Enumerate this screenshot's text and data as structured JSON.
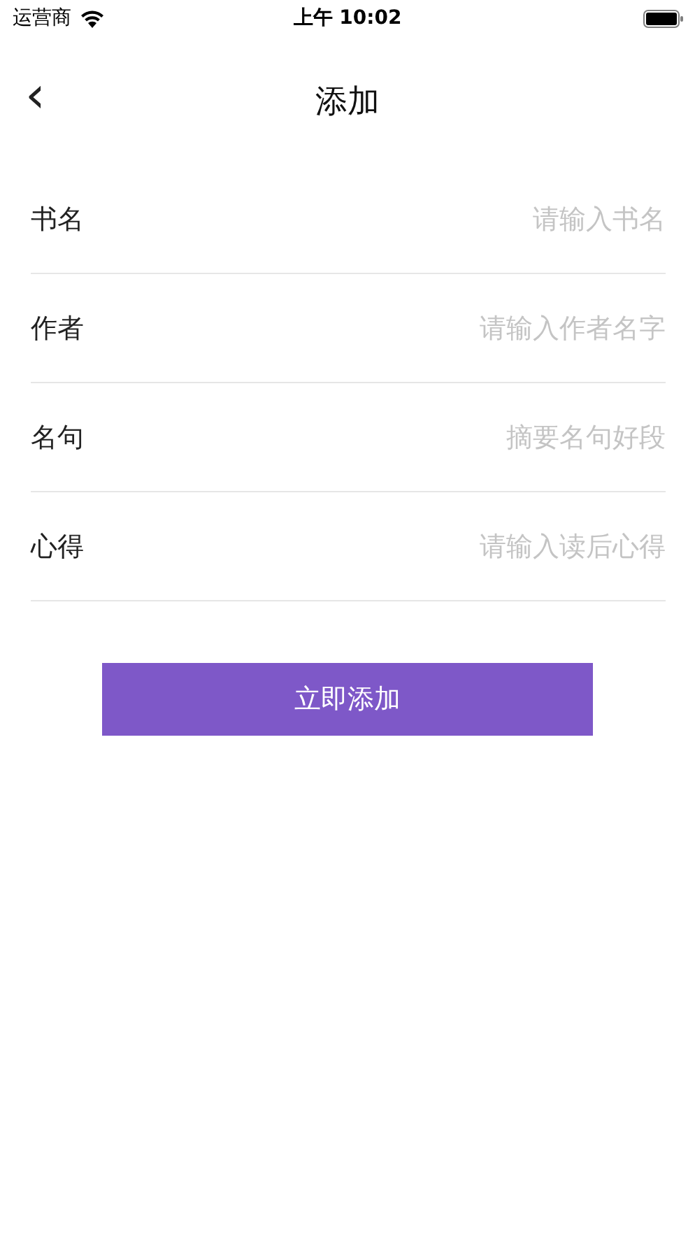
{
  "status_bar": {
    "carrier": "运营商",
    "time": "上午 10:02"
  },
  "nav": {
    "back": "‹",
    "title": "添加"
  },
  "fields": [
    {
      "label": "书名",
      "placeholder": "请输入书名"
    },
    {
      "label": "作者",
      "placeholder": "请输入作者名字"
    },
    {
      "label": "名句",
      "placeholder": "摘要名句好段"
    },
    {
      "label": "心得",
      "placeholder": "请输入读后心得"
    }
  ],
  "submit": "立即添加"
}
